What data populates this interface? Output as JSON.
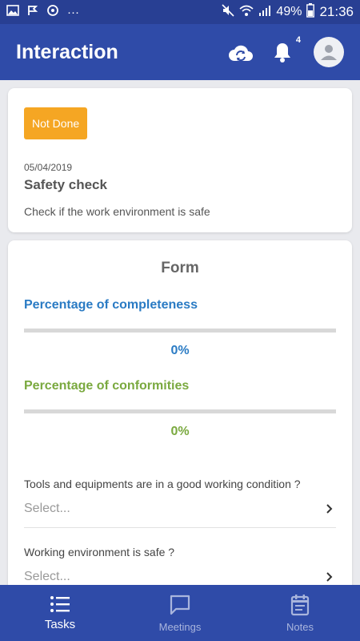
{
  "status_bar": {
    "battery": "49%",
    "time": "21:36",
    "dots": "···"
  },
  "app_bar": {
    "title": "Interaction",
    "notification_count": "4"
  },
  "task": {
    "status": "Not Done",
    "status_color": "#f5a623",
    "date": "05/04/2019",
    "title": "Safety check",
    "description": "Check if the work environment is safe"
  },
  "form": {
    "title": "Form",
    "completeness": {
      "label": "Percentage of completeness",
      "value_text": "0%",
      "progress": 0,
      "color": "#2a7bc4"
    },
    "conformities": {
      "label": "Percentage of conformities",
      "value_text": "0%",
      "progress": 0,
      "color": "#7aa93f"
    },
    "questions": [
      {
        "text": "Tools and equipments are in a good working condition ?",
        "placeholder": "Select..."
      },
      {
        "text": "Working environment is safe ?",
        "placeholder": "Select..."
      }
    ]
  },
  "bottom_nav": {
    "items": [
      {
        "label": "Tasks",
        "icon": "list-icon",
        "active": true
      },
      {
        "label": "Meetings",
        "icon": "chat-icon",
        "active": false
      },
      {
        "label": "Notes",
        "icon": "notes-icon",
        "active": false
      }
    ]
  },
  "colors": {
    "primary": "#2f4ba8",
    "status_bar": "#283f93"
  }
}
